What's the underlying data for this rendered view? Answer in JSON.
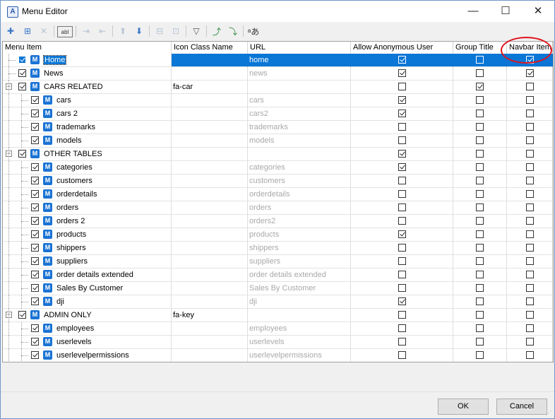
{
  "window": {
    "title": "Menu Editor",
    "app_icon": "A",
    "minimize": "—",
    "maximize": "☐",
    "close": "✕"
  },
  "toolbar": {
    "icons": [
      "add-item-icon",
      "add-child-icon",
      "delete-icon",
      "rename-icon",
      "indent-icon",
      "outdent-icon",
      "move-up-icon",
      "move-down-icon",
      "expand-icon",
      "collapse-icon",
      "filter-icon",
      "import-icon",
      "export-icon",
      "translate-icon"
    ]
  },
  "columns": {
    "menu_item": "Menu Item",
    "icon_class": "Icon Class Name",
    "url": "URL",
    "anon": "Allow Anonymous User",
    "group": "Group Title",
    "navbar": "Navbar Item"
  },
  "rows": [
    {
      "name": "Home",
      "icon": "",
      "url": "home",
      "anon": true,
      "group": false,
      "navbar": true,
      "level": 0,
      "selected": true,
      "enabled": true
    },
    {
      "name": "News",
      "icon": "",
      "url": "news",
      "anon": true,
      "group": false,
      "navbar": true,
      "level": 0,
      "enabled": true
    },
    {
      "name": "CARS RELATED",
      "icon": "fa-car",
      "url": "",
      "anon": false,
      "group": true,
      "navbar": false,
      "level": 0,
      "expander": "−",
      "enabled": true
    },
    {
      "name": "cars",
      "icon": "",
      "url": "cars",
      "anon": true,
      "group": false,
      "navbar": false,
      "level": 1,
      "enabled": true
    },
    {
      "name": "cars 2",
      "icon": "",
      "url": "cars2",
      "anon": true,
      "group": false,
      "navbar": false,
      "level": 1,
      "enabled": true
    },
    {
      "name": "trademarks",
      "icon": "",
      "url": "trademarks",
      "anon": false,
      "group": false,
      "navbar": false,
      "level": 1,
      "enabled": true
    },
    {
      "name": "models",
      "icon": "",
      "url": "models",
      "anon": false,
      "group": false,
      "navbar": false,
      "level": 1,
      "enabled": true
    },
    {
      "name": "OTHER TABLES",
      "icon": "",
      "url": "",
      "anon": true,
      "group": false,
      "navbar": false,
      "level": 0,
      "expander": "−",
      "enabled": true
    },
    {
      "name": "categories",
      "icon": "",
      "url": "categories",
      "anon": true,
      "group": false,
      "navbar": false,
      "level": 1,
      "enabled": true
    },
    {
      "name": "customers",
      "icon": "",
      "url": "customers",
      "anon": false,
      "group": false,
      "navbar": false,
      "level": 1,
      "enabled": true
    },
    {
      "name": "orderdetails",
      "icon": "",
      "url": "orderdetails",
      "anon": false,
      "group": false,
      "navbar": false,
      "level": 1,
      "enabled": true
    },
    {
      "name": "orders",
      "icon": "",
      "url": "orders",
      "anon": false,
      "group": false,
      "navbar": false,
      "level": 1,
      "enabled": true
    },
    {
      "name": "orders 2",
      "icon": "",
      "url": "orders2",
      "anon": false,
      "group": false,
      "navbar": false,
      "level": 1,
      "enabled": true
    },
    {
      "name": "products",
      "icon": "",
      "url": "products",
      "anon": true,
      "group": false,
      "navbar": false,
      "level": 1,
      "enabled": true
    },
    {
      "name": "shippers",
      "icon": "",
      "url": "shippers",
      "anon": false,
      "group": false,
      "navbar": false,
      "level": 1,
      "enabled": true
    },
    {
      "name": "suppliers",
      "icon": "",
      "url": "suppliers",
      "anon": false,
      "group": false,
      "navbar": false,
      "level": 1,
      "enabled": true
    },
    {
      "name": "order details extended",
      "icon": "",
      "url": "order details extended",
      "anon": false,
      "group": false,
      "navbar": false,
      "level": 1,
      "enabled": true
    },
    {
      "name": "Sales By Customer",
      "icon": "",
      "url": "Sales By Customer",
      "anon": false,
      "group": false,
      "navbar": false,
      "level": 1,
      "enabled": true
    },
    {
      "name": "dji",
      "icon": "",
      "url": "dji",
      "anon": true,
      "group": false,
      "navbar": false,
      "level": 1,
      "enabled": true
    },
    {
      "name": "ADMIN ONLY",
      "icon": "fa-key",
      "url": "",
      "anon": false,
      "group": false,
      "navbar": false,
      "level": 0,
      "expander": "−",
      "enabled": true
    },
    {
      "name": "employees",
      "icon": "",
      "url": "employees",
      "anon": false,
      "group": false,
      "navbar": false,
      "level": 1,
      "enabled": true
    },
    {
      "name": "userlevels",
      "icon": "",
      "url": "userlevels",
      "anon": false,
      "group": false,
      "navbar": false,
      "level": 1,
      "enabled": true
    },
    {
      "name": "userlevelpermissions",
      "icon": "",
      "url": "userlevelpermissions",
      "anon": false,
      "group": false,
      "navbar": false,
      "level": 1,
      "enabled": true
    }
  ],
  "menu_icon_glyph": "M",
  "buttons": {
    "ok": "OK",
    "cancel": "Cancel"
  },
  "colors": {
    "selection": "#0a76d6",
    "annotation": "#e0131b",
    "menu_icon": "#1a73d4"
  }
}
